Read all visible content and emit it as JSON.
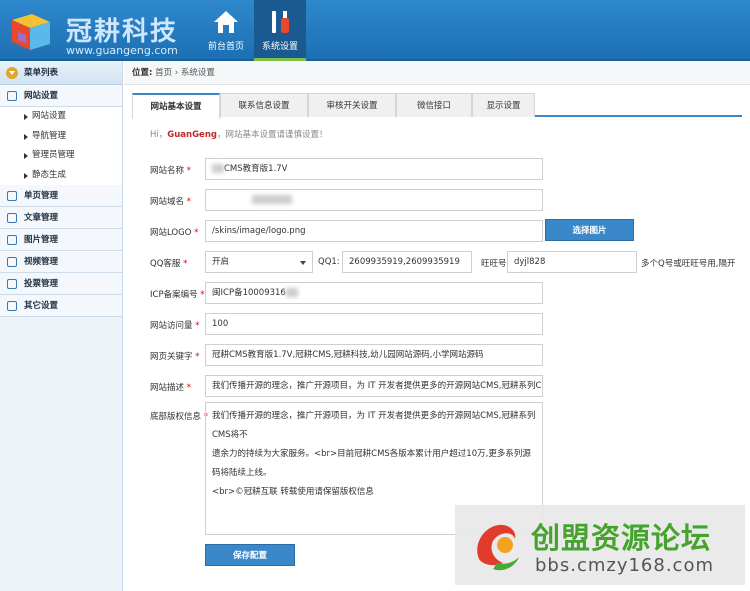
{
  "header": {
    "logo_cn": "冠耕科技",
    "logo_en": "www.guangeng.com",
    "nav": [
      {
        "label": "前台首页"
      },
      {
        "label": "系统设置"
      }
    ]
  },
  "sidebar": {
    "title": "菜单列表",
    "groups": [
      {
        "label": "网站设置",
        "items": [
          "网站设置",
          "导航管理",
          "管理员管理",
          "静态生成"
        ]
      },
      {
        "label": "单页管理"
      },
      {
        "label": "文章管理"
      },
      {
        "label": "图片管理"
      },
      {
        "label": "视频管理"
      },
      {
        "label": "投票管理"
      },
      {
        "label": "其它设置"
      }
    ]
  },
  "breadcrumb": {
    "prefix": "位置:",
    "path": "首页 › 系统设置"
  },
  "tabs": [
    "网站基本设置",
    "联系信息设置",
    "审核开关设置",
    "微信接口",
    "显示设置"
  ],
  "greeting": {
    "hi": "Hi，",
    "user": "GuanGeng",
    "rest": "，网站基本设置请谨慎设置！"
  },
  "form": {
    "site_name": {
      "label": "网站名称",
      "value": "CMS教育版1.7V"
    },
    "site_domain": {
      "label": "网站域名",
      "value": ""
    },
    "site_logo": {
      "label": "网站LOGO",
      "value": "/skins/image/logo.png",
      "button": "选择图片"
    },
    "qq_service": {
      "label": "QQ客服",
      "value": "开启",
      "qq1_label": "QQ1:",
      "qq1_value": "2609935919,2609935919",
      "ww_label": "旺旺号:",
      "ww_value": "dyjl828",
      "note": "多个Q号或旺旺号用,隔开"
    },
    "icp": {
      "label": "ICP备案编号",
      "value": "闽ICP备10009316"
    },
    "visits": {
      "label": "网站访问量",
      "value": "100"
    },
    "keywords": {
      "label": "网页关键字",
      "value": "冠耕CMS教育版1.7V,冠耕CMS,冠耕科技,幼儿园网站源码,小学网站源码"
    },
    "description": {
      "label": "网站描述",
      "value": "我们传播开源的理念，推广开源项目，为 IT 开发者提供更多的开源网站CMS,冠耕系列CMS将不"
    },
    "copyright": {
      "label": "底部版权信息",
      "line1": "我们传播开源的理念，推广开源项目，为 IT 开发者提供更多的开源网站CMS,冠耕系列CMS将不",
      "line2": "遗余力的持续为大家服务。<br>目前冠耕CMS各版本累计用户超过10万,更多系列源码将陆续上线。",
      "line3": "<br>©冠耕互联 转载使用请保留版权信息"
    },
    "save_button": "保存配置"
  },
  "watermark": {
    "cn": "创盟资源论坛",
    "en": "bbs.cmzy168.com"
  }
}
